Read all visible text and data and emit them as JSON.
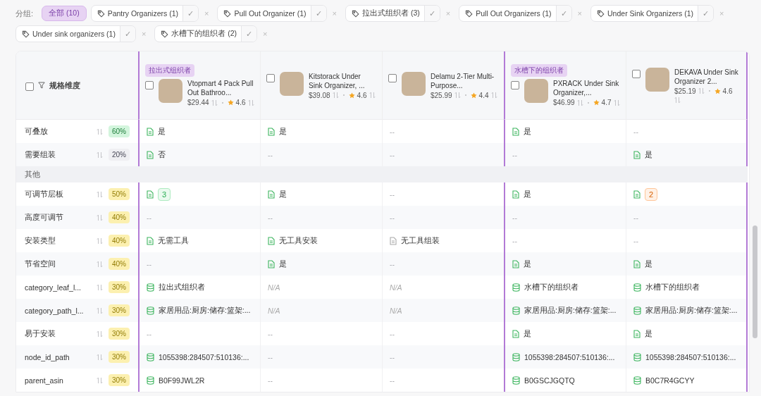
{
  "group_bar": {
    "label": "分组:",
    "chips": [
      {
        "kind": "all",
        "label": "全部 (10)",
        "selected": true
      },
      {
        "kind": "tag",
        "label": "Pantry Organizers (1)",
        "selected": false,
        "confirm": "✓",
        "remove": "×"
      },
      {
        "kind": "tag",
        "label": "Pull Out Organizer (1)",
        "selected": false,
        "confirm": "✓",
        "remove": "×"
      },
      {
        "kind": "tag",
        "label": "拉出式组织者 (3)",
        "selected": false,
        "confirm": "✓",
        "remove": "×"
      },
      {
        "kind": "tag",
        "label": "Pull Out Organizers (1)",
        "selected": false,
        "confirm": "✓",
        "remove": "×"
      },
      {
        "kind": "tag",
        "label": "Under Sink Organizers (1)",
        "selected": false,
        "confirm": "✓",
        "remove": "×"
      },
      {
        "kind": "tag",
        "label": "Under sink organizers (1)",
        "selected": false,
        "confirm": "✓",
        "remove": "×"
      },
      {
        "kind": "tag",
        "label": "水槽下的组织者 (2)",
        "selected": false,
        "confirm": "✓",
        "remove": "×"
      }
    ]
  },
  "table": {
    "header_label": "规格维度",
    "header_checked": false,
    "product_groups": [
      {
        "tag": "拉出式组织者",
        "products": [
          {
            "name": "Vtopmart 4 Pack Pull Out Bathroo...",
            "price": "$29.44",
            "rating": "4.6",
            "checked": false
          },
          {
            "name": "Kitstorack Under Sink Organizer, ...",
            "price": "$39.08",
            "rating": "4.6",
            "checked": false
          },
          {
            "name": "Delamu 2-Tier Multi-Purpose...",
            "price": "$25.99",
            "rating": "4.4",
            "checked": false
          }
        ]
      },
      {
        "tag": "水槽下的组织者",
        "products": [
          {
            "name": "PXRACK Under Sink Organizer,...",
            "price": "$46.99",
            "rating": "4.7",
            "checked": false
          },
          {
            "name": "DEKAVA Under Sink Organizer 2...",
            "price": "$25.19",
            "rating": "4.6",
            "checked": false
          }
        ]
      }
    ],
    "rows": [
      {
        "kind": "attribute",
        "label": "可叠放",
        "share": "60%",
        "color": "#d3f5dd",
        "cells": [
          {
            "kind": "doc",
            "text": "是"
          },
          {
            "kind": "doc",
            "text": "是"
          },
          {
            "kind": "empty",
            "text": "--"
          },
          {
            "kind": "doc",
            "text": "是"
          },
          {
            "kind": "empty",
            "text": "--"
          }
        ]
      },
      {
        "kind": "attribute",
        "label": "需要组装",
        "share": "20%",
        "color": "#efeff2",
        "cells": [
          {
            "kind": "doc",
            "text": "否"
          },
          {
            "kind": "empty",
            "text": "--"
          },
          {
            "kind": "empty",
            "text": "--"
          },
          {
            "kind": "empty",
            "text": "--"
          },
          {
            "kind": "doc",
            "text": "是"
          }
        ]
      },
      {
        "kind": "section",
        "label": "其他"
      },
      {
        "kind": "attribute",
        "label": "可调节层板",
        "share": "50%",
        "color": "#fcf0b0",
        "cells": [
          {
            "kind": "badge",
            "text": "3",
            "color": "#eafaef"
          },
          {
            "kind": "doc",
            "text": "是"
          },
          {
            "kind": "empty",
            "text": "--"
          },
          {
            "kind": "doc",
            "text": "是"
          },
          {
            "kind": "badge",
            "text": "2",
            "color": "#fff1e6"
          }
        ]
      },
      {
        "kind": "attribute",
        "label": "高度可调节",
        "share": "40%",
        "color": "#fcf0b0",
        "cells": [
          {
            "kind": "empty",
            "text": "--"
          },
          {
            "kind": "empty",
            "text": "--"
          },
          {
            "kind": "empty",
            "text": "--"
          },
          {
            "kind": "empty",
            "text": "--"
          },
          {
            "kind": "empty",
            "text": "--"
          }
        ]
      },
      {
        "kind": "attribute",
        "label": "安装类型",
        "share": "40%",
        "color": "#fcf0b0",
        "cells": [
          {
            "kind": "doc",
            "text": "无需工具"
          },
          {
            "kind": "doc",
            "text": "无工具安装"
          },
          {
            "kind": "doc-grey",
            "text": "无工具组装"
          },
          {
            "kind": "empty",
            "text": "--"
          },
          {
            "kind": "empty",
            "text": "--"
          }
        ]
      },
      {
        "kind": "attribute",
        "label": "节省空间",
        "share": "40%",
        "color": "#fcf0b0",
        "cells": [
          {
            "kind": "empty",
            "text": "--"
          },
          {
            "kind": "doc",
            "text": "是"
          },
          {
            "kind": "empty",
            "text": "--"
          },
          {
            "kind": "doc",
            "text": "是"
          },
          {
            "kind": "doc",
            "text": "是"
          }
        ]
      },
      {
        "kind": "attribute",
        "label": "category_leaf_l...",
        "share": "30%",
        "color": "#fcf0b0",
        "cells": [
          {
            "kind": "db",
            "text": "拉出式组织者"
          },
          {
            "kind": "na",
            "text": "N/A"
          },
          {
            "kind": "na",
            "text": "N/A"
          },
          {
            "kind": "db",
            "text": "水槽下的组织者"
          },
          {
            "kind": "db",
            "text": "水槽下的组织者"
          }
        ]
      },
      {
        "kind": "attribute",
        "label": "category_path_l...",
        "share": "30%",
        "color": "#fcf0b0",
        "cells": [
          {
            "kind": "db",
            "text": "家居用品:厨房:储存:篮架:..."
          },
          {
            "kind": "na",
            "text": "N/A"
          },
          {
            "kind": "na",
            "text": "N/A"
          },
          {
            "kind": "db",
            "text": "家居用品:厨房:储存:篮架:..."
          },
          {
            "kind": "db",
            "text": "家居用品:厨房:储存:篮架:..."
          }
        ]
      },
      {
        "kind": "attribute",
        "label": "易于安装",
        "share": "30%",
        "color": "#fcf0b0",
        "cells": [
          {
            "kind": "empty",
            "text": "--"
          },
          {
            "kind": "empty",
            "text": "--"
          },
          {
            "kind": "empty",
            "text": "--"
          },
          {
            "kind": "doc",
            "text": "是"
          },
          {
            "kind": "doc",
            "text": "是"
          }
        ]
      },
      {
        "kind": "attribute",
        "label": "node_id_path",
        "share": "30%",
        "color": "#fcf0b0",
        "cells": [
          {
            "kind": "db",
            "text": "1055398:284507:510136:..."
          },
          {
            "kind": "empty",
            "text": "--"
          },
          {
            "kind": "empty",
            "text": "--"
          },
          {
            "kind": "db",
            "text": "1055398:284507:510136:..."
          },
          {
            "kind": "db",
            "text": "1055398:284507:510136:..."
          }
        ]
      },
      {
        "kind": "attribute",
        "label": "parent_asin",
        "share": "30%",
        "color": "#fcf0b0",
        "cells": [
          {
            "kind": "db",
            "text": "B0F99JWL2R"
          },
          {
            "kind": "empty",
            "text": "--"
          },
          {
            "kind": "empty",
            "text": "--"
          },
          {
            "kind": "db",
            "text": "B0GSCJGQTQ"
          },
          {
            "kind": "db",
            "text": "B0C7R4GCYY"
          }
        ]
      }
    ]
  }
}
